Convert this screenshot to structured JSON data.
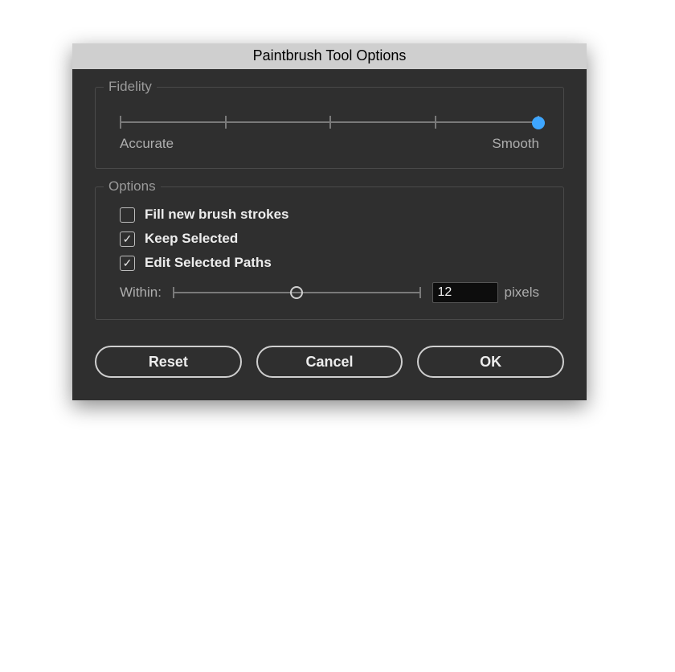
{
  "dialog": {
    "title": "Paintbrush Tool Options",
    "fidelity": {
      "section_title": "Fidelity",
      "left_label": "Accurate",
      "right_label": "Smooth",
      "value_position": 1.0
    },
    "options": {
      "section_title": "Options",
      "fill_new": {
        "label": "Fill new brush strokes",
        "checked": false
      },
      "keep_selected": {
        "label": "Keep Selected",
        "checked": true
      },
      "edit_selected": {
        "label": "Edit Selected Paths",
        "checked": true
      },
      "within": {
        "label": "Within:",
        "value": "12",
        "unit": "pixels",
        "slider_position": 0.5
      }
    },
    "buttons": {
      "reset": "Reset",
      "cancel": "Cancel",
      "ok": "OK"
    }
  }
}
